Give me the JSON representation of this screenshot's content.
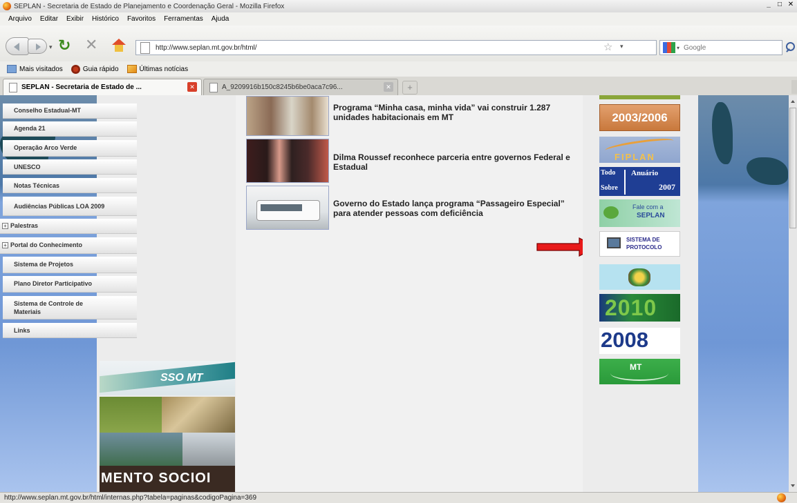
{
  "window": {
    "title": "SEPLAN - Secretaria de Estado de Planejamento e Coordenação Geral - Mozilla Firefox"
  },
  "menu": [
    "Arquivo",
    "Editar",
    "Exibir",
    "Histórico",
    "Favoritos",
    "Ferramentas",
    "Ajuda"
  ],
  "nav": {
    "url": "http://www.seplan.mt.gov.br/html/",
    "search_placeholder": "Google"
  },
  "bookmarks": [
    "Mais visitados",
    "Guia rápido",
    "Últimas notícias"
  ],
  "tabs": [
    {
      "label": "SEPLAN - Secretaria de Estado de ..."
    },
    {
      "label": "A_9209916b150c8245b6be0aca7c96..."
    }
  ],
  "sidebar": {
    "items": [
      {
        "label": "Conselho Estadual-MT"
      },
      {
        "label": "Agenda 21"
      },
      {
        "label": "Operação Arco Verde"
      },
      {
        "label": "UNESCO"
      },
      {
        "label": "Notas Técnicas"
      },
      {
        "label": "Audiências Públicas LOA 2009"
      },
      {
        "label": "Palestras"
      },
      {
        "label": "Portal do Conhecimento"
      },
      {
        "label": "Sistema de Projetos"
      },
      {
        "label": "Plano Diretor Participativo"
      },
      {
        "label": "Sistema de Controle de Materiais"
      },
      {
        "label": "Links"
      }
    ],
    "banner_text": "SSO MT",
    "collage_text": "MENTO SOCIOI"
  },
  "news": [
    {
      "title": "Programa “Minha casa, minha vida” vai construir 1.287 unidades habitacionais em MT"
    },
    {
      "title": "Dilma Roussef reconhece parceria entre governos Federal e Estadual"
    },
    {
      "title": "Governo do Estado lança programa “Passageiro Especial” para atender pessoas com deficiência"
    }
  ],
  "right_banners": {
    "b2003": "2003/2006",
    "fiplan": "FIPLAN",
    "anuario_todo": "Todo",
    "anuario_sobre": "Sobre",
    "anuario_title": "Anuário",
    "anuario_year": "2007",
    "fale_line1": "Fale com a",
    "fale_line2": "SEPLAN",
    "protocolo_line1": "SISTEMA DE",
    "protocolo_line2": "PROTOCOLO",
    "b2010": "2010",
    "b2008": "2008",
    "mt": "MT"
  },
  "status": {
    "text": "http://www.seplan.mt.gov.br/html/internas.php?tabela=paginas&codigoPagina=369"
  }
}
